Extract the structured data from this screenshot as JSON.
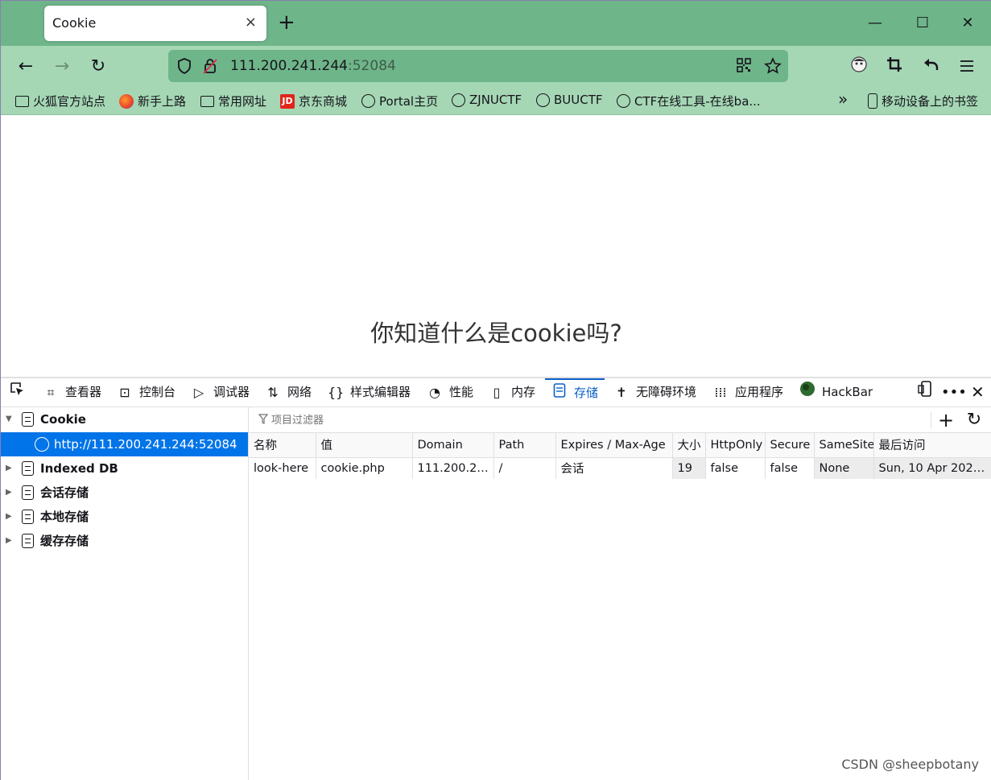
{
  "browser": {
    "tab_title": "Cookie",
    "tab_close": "×",
    "new_tab": "+",
    "window": {
      "minimize": "—",
      "maximize": "☐",
      "close": "✕"
    },
    "url_host": "111.200.241.244",
    "url_port": ":52084",
    "nav": {
      "back": "←",
      "forward": "→",
      "reload": "↻"
    }
  },
  "bookmarks": {
    "items": [
      {
        "label": "火狐官方站点",
        "icon": "folder-icon"
      },
      {
        "label": "新手上路",
        "icon": "firefox-icon"
      },
      {
        "label": "常用网址",
        "icon": "folder-icon"
      },
      {
        "label": "京东商城",
        "icon": "jd-icon",
        "icon_text": "JD"
      },
      {
        "label": "Portal主页",
        "icon": "globe-icon"
      },
      {
        "label": "ZJNUCTF",
        "icon": "globe-icon"
      },
      {
        "label": "BUUCTF",
        "icon": "globe-icon"
      },
      {
        "label": "CTF在线工具-在线ba...",
        "icon": "globe-icon"
      }
    ],
    "overflow": "»",
    "mobile": "移动设备上的书签"
  },
  "page": {
    "heading": "你知道什么是cookie吗?"
  },
  "devtools": {
    "tabs": [
      {
        "label": "查看器",
        "icon": "inspector-icon"
      },
      {
        "label": "控制台",
        "icon": "console-icon"
      },
      {
        "label": "调试器",
        "icon": "debugger-icon"
      },
      {
        "label": "网络",
        "icon": "network-icon"
      },
      {
        "label": "样式编辑器",
        "icon": "style-editor-icon"
      },
      {
        "label": "性能",
        "icon": "performance-icon"
      },
      {
        "label": "内存",
        "icon": "memory-icon"
      },
      {
        "label": "存储",
        "icon": "storage-icon"
      },
      {
        "label": "无障碍环境",
        "icon": "accessibility-icon"
      },
      {
        "label": "应用程序",
        "icon": "application-icon"
      },
      {
        "label": "HackBar",
        "icon": "hackbar-icon"
      }
    ],
    "active_tab": "存储",
    "sidebar": {
      "cookie": "Cookie",
      "cookie_host": "http://111.200.241.244:52084",
      "indexeddb": "Indexed DB",
      "session": "会话存储",
      "local": "本地存储",
      "cache": "缓存存储"
    },
    "filter_placeholder": "项目过滤器",
    "table": {
      "headers": [
        "名称",
        "值",
        "Domain",
        "Path",
        "Expires / Max-Age",
        "大小",
        "HttpOnly",
        "Secure",
        "SameSite",
        "最后访问"
      ],
      "rows": [
        [
          "look-here",
          "cookie.php",
          "111.200.241....",
          "/",
          "会话",
          "19",
          "false",
          "false",
          "None",
          "Sun, 10 Apr 2022 ..."
        ]
      ]
    }
  },
  "watermark": "CSDN @sheepbotany",
  "colors": {
    "titlebar": "#6fb58a",
    "toolbar": "#a5d7b5",
    "accent": "#0a61c6",
    "selection": "#0074e8"
  }
}
